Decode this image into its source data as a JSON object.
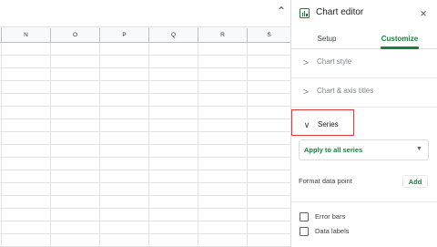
{
  "sheet": {
    "columns": [
      "N",
      "O",
      "P",
      "Q",
      "R",
      "S"
    ],
    "collapse_caret": "⌃"
  },
  "editor": {
    "title": "Chart editor",
    "close_glyph": "×",
    "tabs": {
      "setup": "Setup",
      "customize": "Customize",
      "active": "Customize"
    },
    "sections": {
      "chart_style": {
        "label": "Chart style",
        "expanded": false
      },
      "axis_titles": {
        "label": "Chart & axis titles",
        "expanded": false
      },
      "series": {
        "label": "Series",
        "expanded": true
      }
    },
    "series": {
      "apply_select": "Apply to all series",
      "format_data_point": "Format data point",
      "add_label": "Add",
      "checkboxes": {
        "error_bars": {
          "label": "Error bars",
          "checked": false
        },
        "data_labels": {
          "label": "Data labels",
          "checked": false
        }
      }
    },
    "colors": {
      "accent": "#188038",
      "highlight": "#e53935"
    }
  }
}
